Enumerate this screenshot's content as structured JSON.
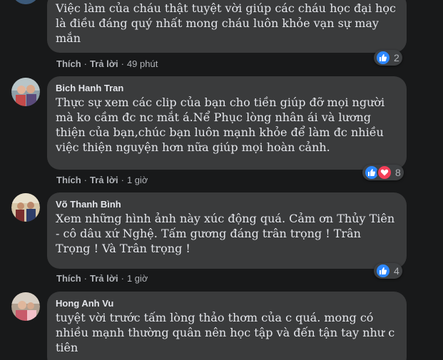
{
  "comments": [
    {
      "author": "",
      "text": "Việc làm của cháu thật tuyệt vời giúp các cháu học đại học là điều đáng quý nhất mong cháu luôn khỏe vạn sự may mắn",
      "like_label": "Thích",
      "reply_label": "Trả lời",
      "time": "49 phút",
      "reactions": [
        "like"
      ],
      "reaction_count": "2"
    },
    {
      "author": "Bich Hanh Tran",
      "text": "Thực sự xem các clip của bạn cho tiền giúp đỡ mọi người mà ko cầm đc nc mắt á.Nể Phục lòng nhân ái và lương thiện của bạn,chúc bạn luôn mạnh khỏe để làm đc nhiều việc thiện nguyện hơn nữa giúp mọi hoàn cảnh.",
      "like_label": "Thích",
      "reply_label": "Trả lời",
      "time": "1 giờ",
      "reactions": [
        "like",
        "love"
      ],
      "reaction_count": "8"
    },
    {
      "author": "Võ Thanh Bình",
      "text": "Xem những hình ảnh này xúc động quá. Cảm ơn Thủy Tiên - cô dâu xứ Nghệ. Tấm gương đáng trân trọng ! Trân Trọng ! Và Trân trọng !",
      "like_label": "Thích",
      "reply_label": "Trả lời",
      "time": "1 giờ",
      "reactions": [
        "like"
      ],
      "reaction_count": "4"
    },
    {
      "author": "Hong Anh Vu",
      "text": "tuyệt vời trước tấm lòng thảo thơm của c quá. mong có nhiều mạnh thường quân nên học tập và đến tận tay như c tiên"
    }
  ],
  "colors": {
    "background": "#18191a",
    "bubble": "#3a3b3c",
    "text": "#e4e6eb",
    "secondary_text": "#b0b3b8",
    "like_blue": "#2d88ff",
    "love_red": "#f33e58"
  }
}
